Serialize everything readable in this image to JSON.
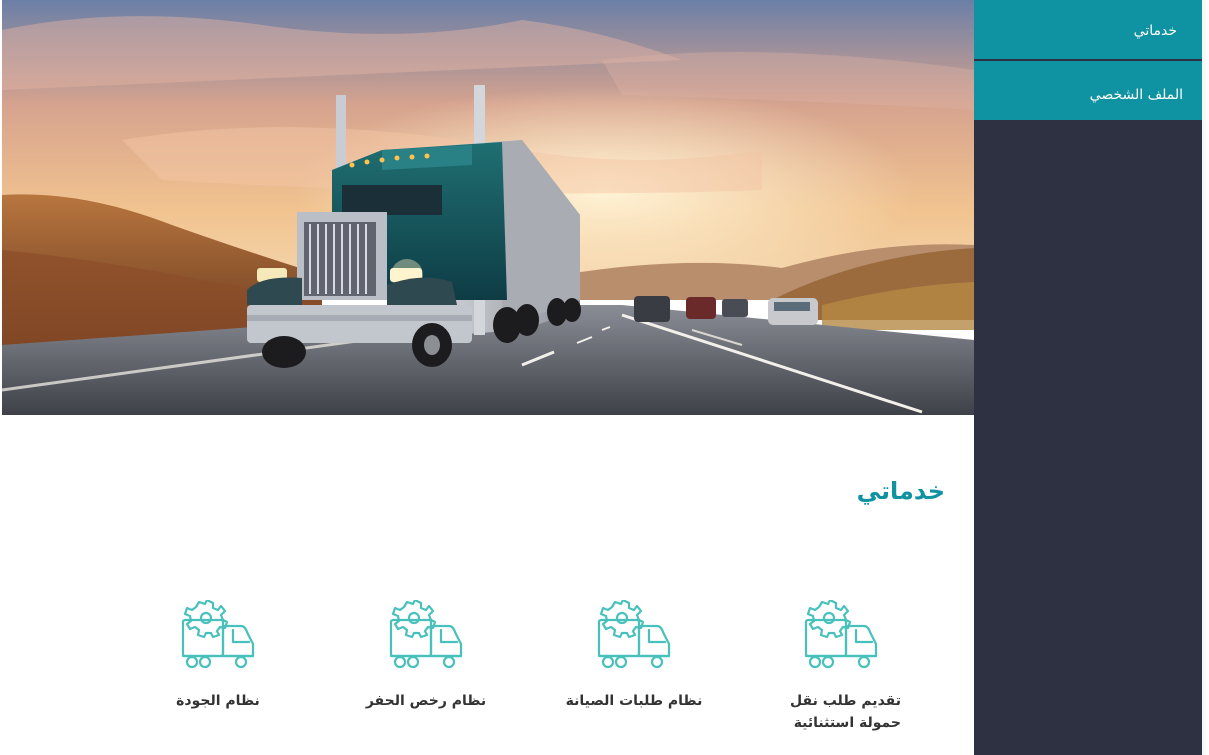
{
  "sidebar": {
    "items": [
      {
        "label": "خدماتي"
      },
      {
        "label": "الملف الشخصي"
      }
    ]
  },
  "hero": {
    "image_subject": "truck-on-highway-at-sunset"
  },
  "main": {
    "title": "خدماتي",
    "services": [
      {
        "label": "تقديم طلب نقل حمولة استثنائية",
        "icon": "truck-gear-icon"
      },
      {
        "label": "نظام طلبات الصيانة",
        "icon": "truck-gear-icon"
      },
      {
        "label": "نظام رخص الحفر",
        "icon": "truck-gear-icon"
      },
      {
        "label": "نظام الجودة",
        "icon": "truck-gear-icon"
      }
    ]
  },
  "colors": {
    "accent": "#0f93a2",
    "sidebar_bg": "#2d3141",
    "text": "#333333",
    "icon_stroke": "#48c1bc"
  }
}
